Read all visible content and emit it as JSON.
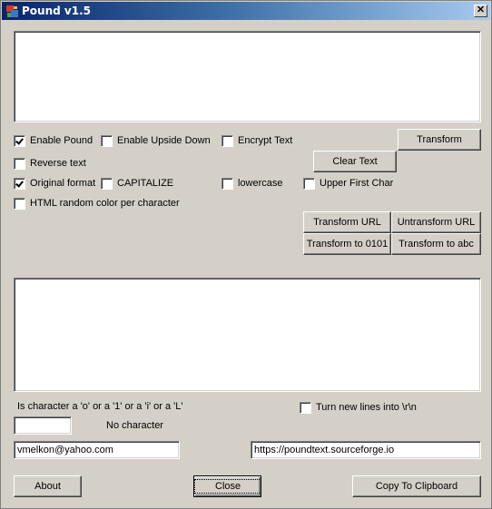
{
  "window": {
    "title": "Pound v1.5",
    "close_glyph": "✕"
  },
  "input_text": {
    "value": ""
  },
  "output_text": {
    "value": ""
  },
  "options": {
    "enable_pound": {
      "label": "Enable Pound",
      "checked": true
    },
    "enable_upside_down": {
      "label": "Enable Upside Down",
      "checked": false
    },
    "encrypt_text": {
      "label": "Encrypt Text",
      "checked": false
    },
    "reverse_text": {
      "label": "Reverse text",
      "checked": false
    },
    "original_format": {
      "label": "Original format",
      "checked": true
    },
    "capitalize": {
      "label": "CAPITALIZE",
      "checked": false
    },
    "lowercase": {
      "label": "lowercase",
      "checked": false
    },
    "upper_first_char": {
      "label": "Upper First Char",
      "checked": false
    },
    "html_random_color": {
      "label": "HTML random color per character",
      "checked": false
    },
    "newlines_crlf": {
      "label": "Turn new lines into \\r\\n",
      "checked": false
    }
  },
  "buttons": {
    "transform": "Transform",
    "clear_text": "Clear Text",
    "transform_url": "Transform URL",
    "untransform_url": "Untransform URL",
    "transform_0101": "Transform to 0101",
    "transform_abc": "Transform to abc",
    "about": "About",
    "close": "Close",
    "copy": "Copy To Clipboard"
  },
  "char_check": {
    "label": "Is character a 'o' or a '1' or a 'i' or a 'L'",
    "value": "",
    "result": "No character"
  },
  "email": "vmelkon@yahoo.com",
  "website": "https://poundtext.sourceforge.io"
}
